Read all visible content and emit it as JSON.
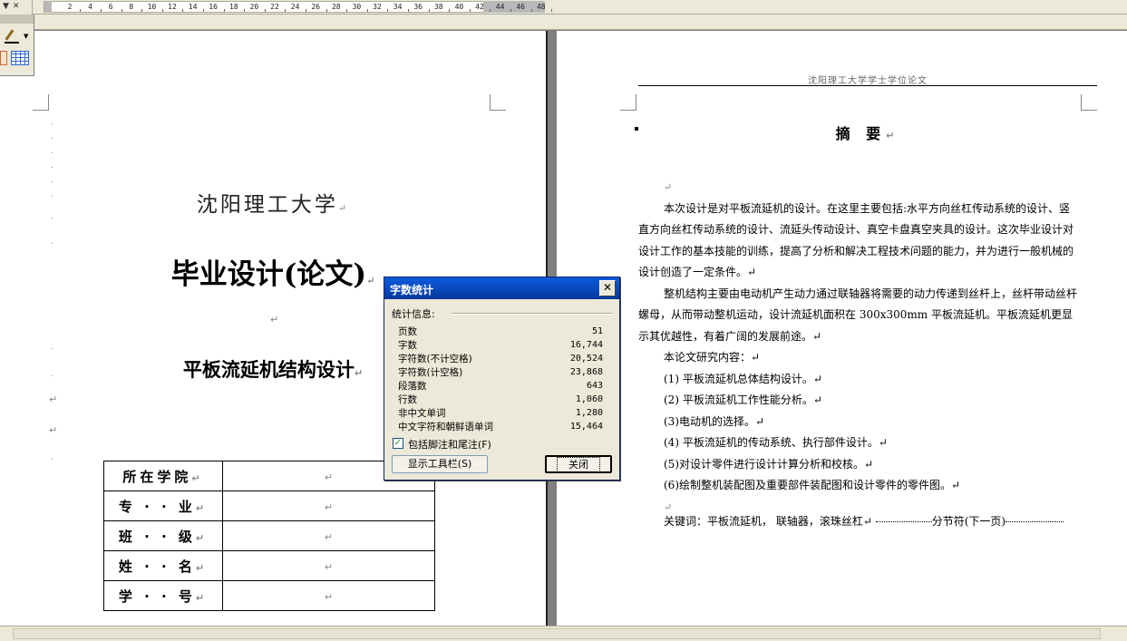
{
  "ruler": {
    "corner": "▼✕",
    "ticks": [
      "2",
      "4",
      "6",
      "8",
      "10",
      "12",
      "14",
      "16",
      "18",
      "20",
      "22",
      "24",
      "26",
      "28",
      "30",
      "32",
      "34",
      "36",
      "38",
      "40",
      "42",
      "44",
      "46",
      "48"
    ]
  },
  "left_page": {
    "school": "沈阳理工大学",
    "thesis_label": "毕业设计(论文)",
    "project_title": "平板流延机结构设计",
    "para_mark": "↵",
    "table_rows": [
      {
        "label": "所在学院",
        "value": ""
      },
      {
        "label": "专 · · 业",
        "value": ""
      },
      {
        "label": "班 · · 级",
        "value": ""
      },
      {
        "label": "姓 · · 名",
        "value": ""
      },
      {
        "label": "学 · · 号",
        "value": ""
      }
    ]
  },
  "right_page": {
    "header": "沈阳理工大学学士学位论文",
    "abstract_title": "摘 要",
    "paragraphs": [
      "本次设计是对平板流延机的设计。在这里主要包括:水平方向丝杠传动系统的设计、竖直方向丝杠传动系统的设计、流延头传动设计、真空卡盘真空夹具的设计。这次毕业设计对设计工作的基本技能的训练，提高了分析和解决工程技术问题的能力，并为进行一般机械的设计创造了一定条件。↵",
      "整机结构主要由电动机产生动力通过联轴器将需要的动力传递到丝杆上，丝杆带动丝杆螺母，从而带动整机运动，设计流延机面积在 300x300mm 平板流延机。平板流延机更显示其优越性，有着广阔的发展前途。↵",
      "本论文研究内容：↵"
    ],
    "list_items": [
      "(1) 平板流延机总体结构设计。↵",
      "(2) 平板流延机工作性能分析。↵",
      "(3)电动机的选择。↵",
      "(4) 平板流延机的传动系统、执行部件设计。↵",
      "(5)对设计零件进行设计计算分析和校核。↵",
      "(6)绘制整机装配图及重要部件装配图和设计零件的零件图。↵"
    ],
    "keywords_label": "关键词：",
    "keywords": "平板流延机，  联轴器，滚珠丝杠↵",
    "section_break": "分节符(下一页)"
  },
  "dialog": {
    "title": "字数统计",
    "close_icon": "✕",
    "stats_label": "统计信息:",
    "stats": [
      {
        "label": "页数",
        "value": "51"
      },
      {
        "label": "字数",
        "value": "16,744"
      },
      {
        "label": "字符数(不计空格)",
        "value": "20,524"
      },
      {
        "label": "字符数(计空格)",
        "value": "23,868"
      },
      {
        "label": "段落数",
        "value": "643"
      },
      {
        "label": "行数",
        "value": "1,060"
      },
      {
        "label": "非中文单词",
        "value": "1,280"
      },
      {
        "label": "中文字符和朝鲜语单词",
        "value": "15,464"
      }
    ],
    "include_checked": true,
    "include_label": "包括脚注和尾注(F)",
    "show_toolbar_button": "显示工具栏(S)",
    "close_button": "关闭"
  },
  "colors": {
    "titlebar": "#0a5bdc",
    "chrome": "#ece9d8",
    "workspace": "#808080"
  }
}
